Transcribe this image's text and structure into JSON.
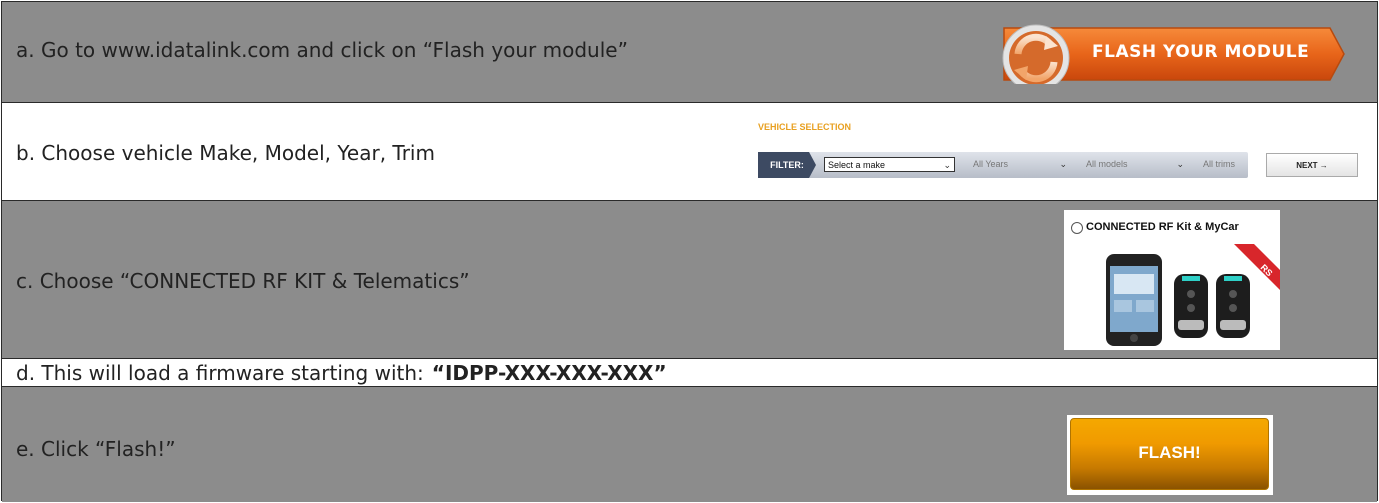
{
  "steps": {
    "a": "a. Go to www.idatalink.com and click on “Flash your module”",
    "b": "b. Choose vehicle Make, Model, Year, Trim",
    "c": "c. Choose “CONNECTED RF KIT & Telematics”",
    "d_prefix": "d. This will load a firmware starting with:",
    "d_firmware": "“IDPP-XXX-XXX-XXX”",
    "e": "e. Click “Flash!”"
  },
  "flash_module_button": {
    "label": "FLASH YOUR MODULE"
  },
  "vehicle_selection": {
    "title": "VEHICLE SELECTION",
    "filter_label": "FILTER:",
    "make": "Select a make",
    "year": "All Years",
    "model": "All models",
    "trim": "All trims",
    "next_label": "NEXT →"
  },
  "rf_kit": {
    "title": "CONNECTED RF Kit & MyCar",
    "badge": "RS"
  },
  "flash_button": {
    "label": "FLASH!"
  },
  "colors": {
    "row_gray": "#8c8c8c",
    "orange": "#e8651a",
    "flash_orange": "#f5a800",
    "filter_navy": "#3d4a62"
  }
}
